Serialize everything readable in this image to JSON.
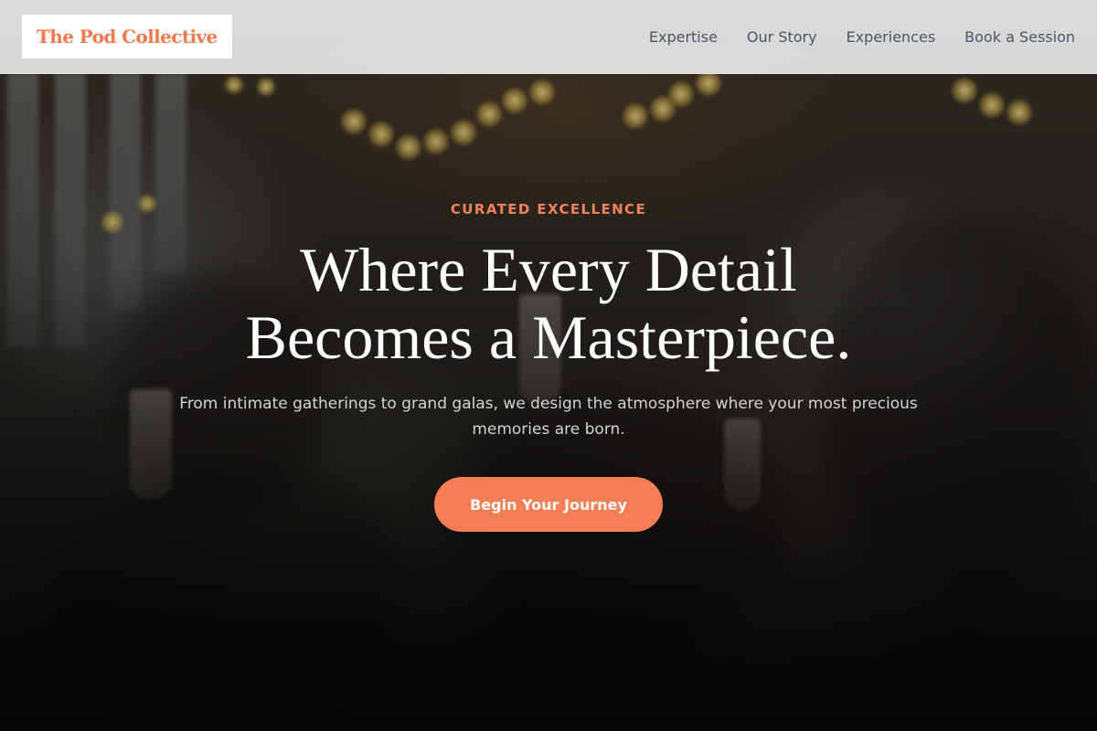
{
  "brand": {
    "name": "The Pod Collective",
    "accent_color": "#f47e53"
  },
  "nav": {
    "items": [
      {
        "label": "Expertise"
      },
      {
        "label": "Our Story"
      },
      {
        "label": "Experiences"
      },
      {
        "label": "Book a Session"
      }
    ]
  },
  "hero": {
    "eyebrow": "CURATED EXCELLENCE",
    "headline_line1": "Where Every Detail",
    "headline_line2": "Becomes a Masterpiece.",
    "subtitle": "From intimate gatherings to grand galas, we design the atmosphere where your most precious memories are born.",
    "cta_label": "Begin Your Journey",
    "background_image": "blurred-celebration-photo"
  }
}
